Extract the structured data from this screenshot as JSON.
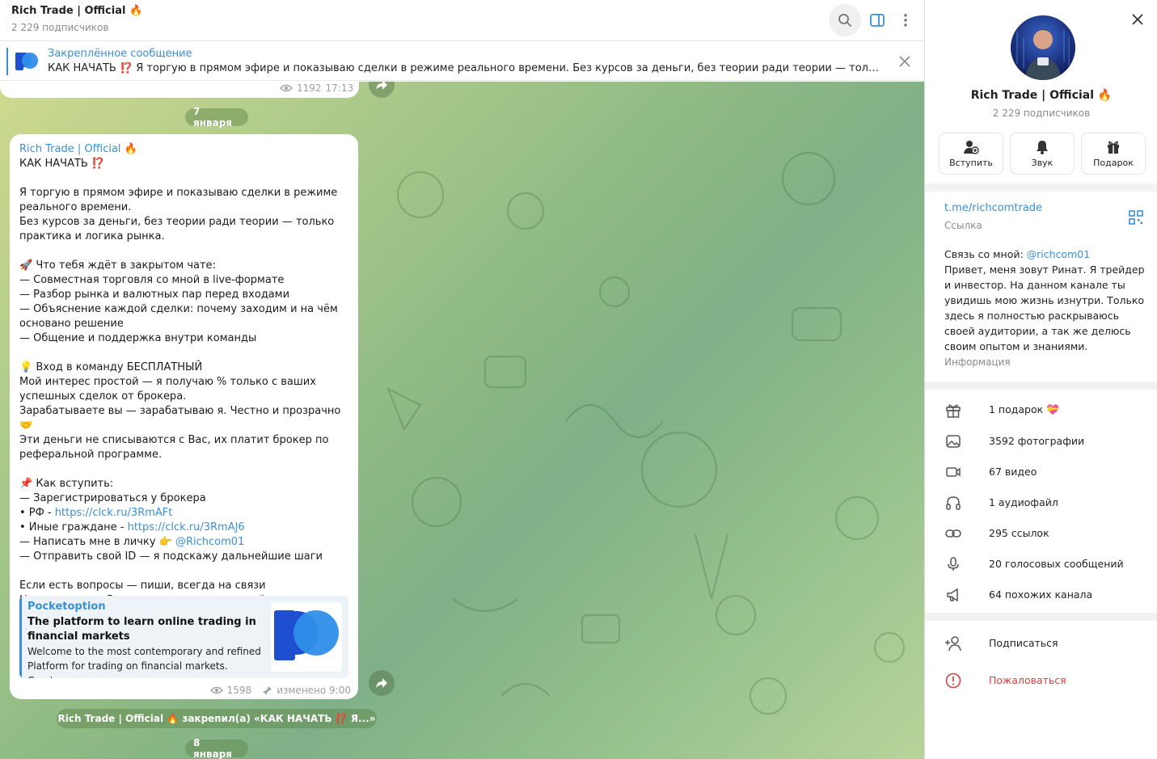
{
  "chat": {
    "title": "Rich Trade | Official 🔥",
    "subscribers": "2 229 подписчиков",
    "pinned": {
      "title": "Закреплённое сообщение",
      "text": "КАК НАЧАТЬ ⁉️ Я торгую в прямом эфире и показываю сделки в режиме реального времени. Без курсов за деньги, без теории ради теории — только практика и..."
    },
    "prev_message": {
      "views": "1192",
      "time": "17:13"
    },
    "date_1": "7 января",
    "message": {
      "author": "Rich Trade | Official 🔥",
      "intro": "КАК НАЧАТЬ ⁉️\n\nЯ торгую в прямом эфире и показываю сделки в режиме реального времени.\nБез курсов за деньги, без теории ради теории — только практика и логика рынка.\n\n🚀 Что тебя ждёт в закрытом чате:\n— Совместная торговля со мной в live-формате\n— Разбор рынка и валютных пар перед входами\n— Объяснение каждой сделки: почему заходим и на чём основано решение\n— Общение и поддержка внутри команды\n\n💡 Вход в команду БЕСПЛАТНЫЙ\nМой интерес простой — я получаю % только с ваших успешных сделок от брокера.\nЗарабатываете вы — зарабатываю я. Честно и прозрачно 🤝\nЭти деньги не списываются с Вас, их платит брокер по реферальной программе.\n\n📌 Как вступить:\n— Зарегистрироваться у брокера",
      "rf_prefix": "• РФ - ",
      "rf_link": "https://clck.ru/3RmAFt",
      "other_prefix": "• Иные граждане - ",
      "other_link": "https://clck.ru/3RmAJ6",
      "dm_prefix": "— Написать мне в личку 👉 ",
      "dm_link": "@Richcom01",
      "outro": "— Отправить свой ID — я подскажу дальнейшие шаги\n\nЕсли есть вопросы — пиши, всегда на связи\nНе тяни время. В рынок заходят те, кто действует.",
      "preview": {
        "site": "Pocketoption",
        "title": "The platform to learn online trading in financial markets",
        "description": "Welcome to the most contemporary and refined Platform for trading on financial markets. Creat..."
      },
      "views": "1598",
      "edited": "изменено 9:00"
    },
    "service": "Rich Trade | Official 🔥 закрепил(а) «КАК НАЧАТЬ ⁉️ Я...»",
    "date_2": "8 января"
  },
  "info": {
    "name": "Rich Trade | Official 🔥",
    "subscribers": "2 229 подписчиков",
    "actions": [
      {
        "label": "Вступить",
        "icon": "add-user-icon"
      },
      {
        "label": "Звук",
        "icon": "bell-icon"
      },
      {
        "label": "Подарок",
        "icon": "gift-icon"
      }
    ],
    "link": "t.me/richcomtrade",
    "link_label": "Ссылка",
    "about_prefix": "Связь со мной: ",
    "about_handle": "@richcom01",
    "about_text": "Привет, меня зовут Ринат. Я трейдер и инвестор. На данном канале ты увидишь мою жизнь изнутри. Только здесь я полностью раскрываюсь своей аудитории, а так же делюсь своим опытом и знаниями.",
    "about_label": "Информация",
    "media": [
      {
        "label": "1 подарок 💝",
        "icon": "gift-icon"
      },
      {
        "label": "3592 фотографии",
        "icon": "photo-icon"
      },
      {
        "label": "67 видео",
        "icon": "video-icon"
      },
      {
        "label": "1 аудиофайл",
        "icon": "headphones-icon"
      },
      {
        "label": "295 ссылок",
        "icon": "link-icon"
      },
      {
        "label": "20 голосовых сообщений",
        "icon": "microphone-icon"
      },
      {
        "label": "64 похожих канала",
        "icon": "megaphone-icon"
      }
    ],
    "subscribe": "Подписаться",
    "report": "Пожаловаться"
  },
  "colors": {
    "accent": "#3a8fd6",
    "danger": "#d94040"
  }
}
